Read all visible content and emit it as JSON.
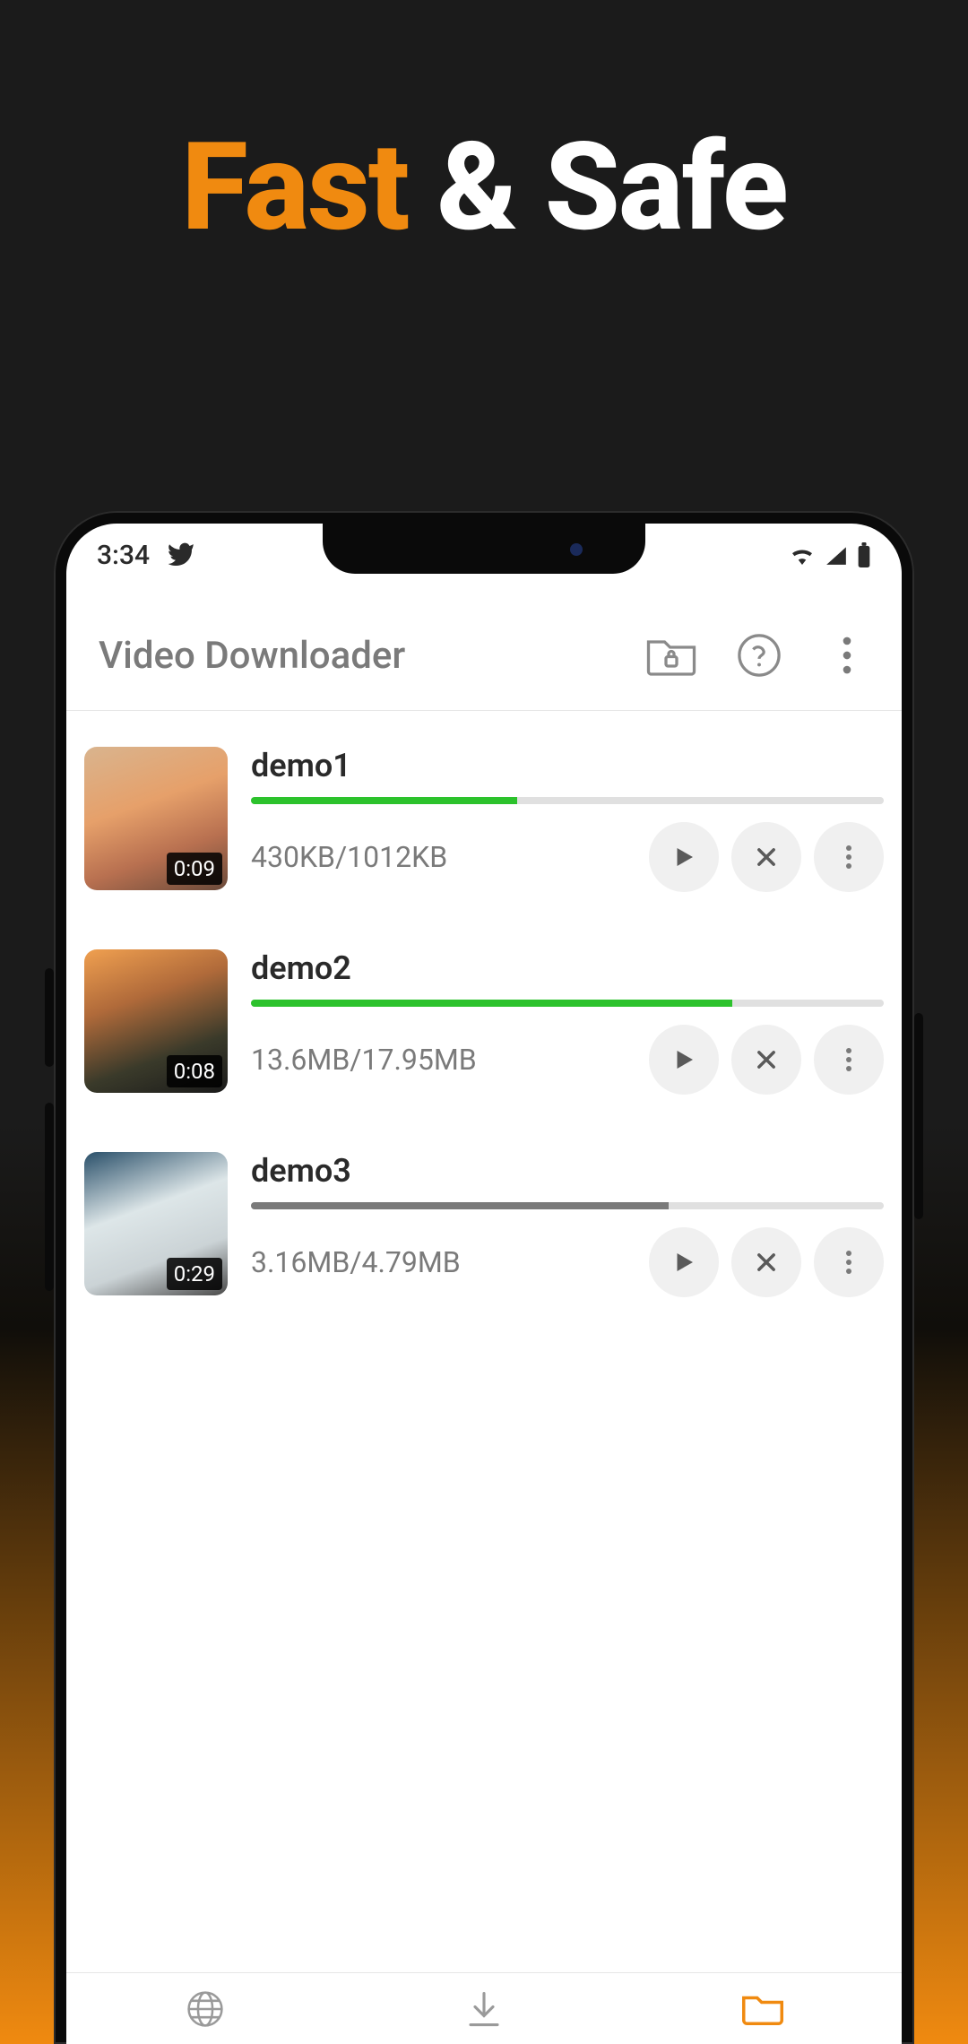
{
  "headline": {
    "word1": "Fast",
    "amp": "&",
    "word2": "Safe"
  },
  "status": {
    "time": "3:34"
  },
  "app": {
    "title": "Video Downloader"
  },
  "downloads": [
    {
      "title": "demo1",
      "duration": "0:09",
      "status": "430KB/1012KB",
      "progress": 42,
      "bar": "green"
    },
    {
      "title": "demo2",
      "duration": "0:08",
      "status": "13.6MB/17.95MB",
      "progress": 76,
      "bar": "green"
    },
    {
      "title": "demo3",
      "duration": "0:29",
      "status": "3.16MB/4.79MB",
      "progress": 66,
      "bar": "grey"
    }
  ]
}
